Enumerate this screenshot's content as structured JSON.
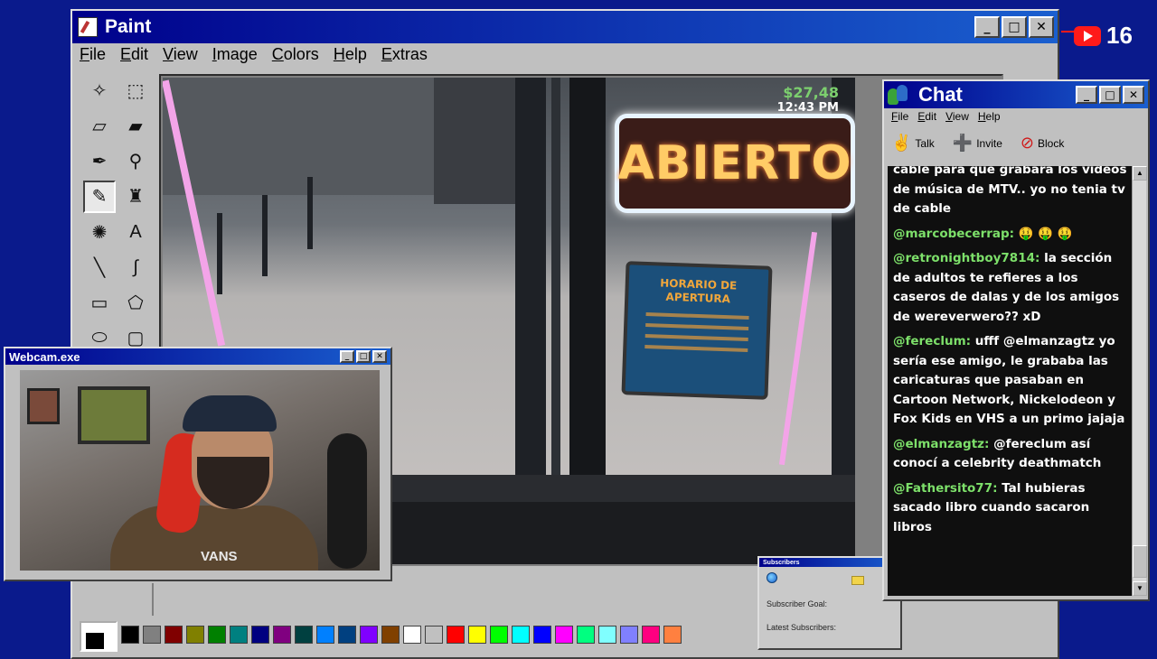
{
  "paint": {
    "title": "Paint",
    "menu": [
      "File",
      "Edit",
      "View",
      "Image",
      "Colors",
      "Help",
      "Extras"
    ],
    "tools": [
      {
        "name": "free-select-icon",
        "glyph": "✧"
      },
      {
        "name": "rect-select-icon",
        "glyph": "⬚"
      },
      {
        "name": "eraser-icon",
        "glyph": "▱"
      },
      {
        "name": "fill-bucket-icon",
        "glyph": "▰"
      },
      {
        "name": "color-picker-icon",
        "glyph": "✒"
      },
      {
        "name": "magnifier-icon",
        "glyph": "⚲"
      },
      {
        "name": "pencil-icon",
        "glyph": "✎",
        "active": true
      },
      {
        "name": "brush-icon",
        "glyph": "♜"
      },
      {
        "name": "airbrush-icon",
        "glyph": "✺"
      },
      {
        "name": "text-icon",
        "glyph": "A"
      },
      {
        "name": "line-icon",
        "glyph": "╲"
      },
      {
        "name": "curve-icon",
        "glyph": "∫"
      },
      {
        "name": "rectangle-icon",
        "glyph": "▭"
      },
      {
        "name": "polygon-icon",
        "glyph": "⬠"
      },
      {
        "name": "ellipse-icon",
        "glyph": "⬭"
      },
      {
        "name": "rounded-rect-icon",
        "glyph": "▢"
      }
    ],
    "palette": [
      "#000000",
      "#808080",
      "#800000",
      "#808000",
      "#008000",
      "#008080",
      "#000080",
      "#800080",
      "#004040",
      "#0080ff",
      "#004080",
      "#8000ff",
      "#804000",
      "#ffffff",
      "#c0c0c0",
      "#ff0000",
      "#ffff00",
      "#00ff00",
      "#00ffff",
      "#0000ff",
      "#ff00ff",
      "#00ff80",
      "#80ffff",
      "#8080ff",
      "#ff0080",
      "#ff8040"
    ]
  },
  "game": {
    "money": "$27,48",
    "time": "12:43 PM",
    "sign_open": "ABIERTO",
    "sign_hours_title": "HORARIO DE APERTURA"
  },
  "webcam": {
    "title": "Webcam.exe",
    "shirt_text": "VANS"
  },
  "chat": {
    "title": "Chat",
    "menu": [
      "File",
      "Edit",
      "View",
      "Help"
    ],
    "tools": [
      {
        "label": "Talk",
        "icon": "talk-icon",
        "glyph": "✌"
      },
      {
        "label": "Invite",
        "icon": "invite-icon",
        "glyph": "➕"
      },
      {
        "label": "Block",
        "icon": "block-icon",
        "glyph": "⊘"
      }
    ],
    "cut_line": "cable para que grabara los videos",
    "lines_top": "de música de MTV.. yo no tenia tv de cable",
    "messages": [
      {
        "user": "@marcobecerrap:",
        "text": "🤑 🤑 🤑"
      },
      {
        "user": "@retronightboy7814:",
        "text": "la sección de adultos te refieres a los caseros de dalas y de los amigos de wereverwero?? xD"
      },
      {
        "user": "@fereclum:",
        "text": "ufff @elmanzagtz yo sería ese amigo, le grababa las caricaturas que pasaban en Cartoon Network, Nickelodeon y Fox Kids en VHS a un primo jajaja"
      },
      {
        "user": "@elmanzagtz:",
        "text": "@fereclum así conocí a celebrity deathmatch"
      },
      {
        "user": "@Fathersito77:",
        "text": "Tal hubieras sacado libro cuando sacaron libros"
      }
    ]
  },
  "subscribers": {
    "title": "Subscribers",
    "goal_label": "Subscriber Goal:",
    "latest_label": "Latest Subscribers:"
  },
  "youtube": {
    "count": "16"
  }
}
